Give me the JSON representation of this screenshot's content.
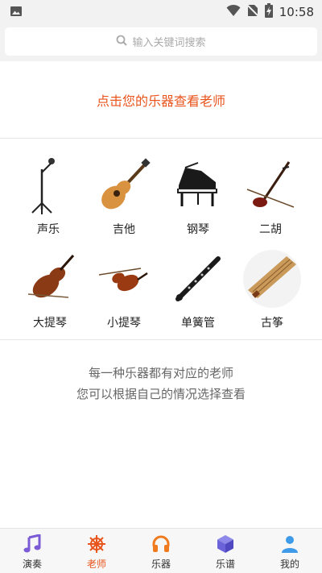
{
  "status_bar": {
    "time": "10:58"
  },
  "search": {
    "placeholder": "输入关键词搜索"
  },
  "prompt": {
    "text": "点击您的乐器查看老师"
  },
  "instruments": [
    {
      "label": "声乐",
      "icon": "microphone-stand-icon"
    },
    {
      "label": "吉他",
      "icon": "guitar-icon"
    },
    {
      "label": "钢琴",
      "icon": "grand-piano-icon"
    },
    {
      "label": "二胡",
      "icon": "erhu-icon"
    },
    {
      "label": "大提琴",
      "icon": "cello-icon"
    },
    {
      "label": "小提琴",
      "icon": "violin-icon"
    },
    {
      "label": "单簧管",
      "icon": "clarinet-icon"
    },
    {
      "label": "古筝",
      "icon": "guzheng-icon"
    }
  ],
  "info": {
    "line1": "每一种乐器都有对应的老师",
    "line2": "您可以根据自己的情况选择查看"
  },
  "tabs": [
    {
      "label": "演奏",
      "icon": "music-note-icon"
    },
    {
      "label": "老师",
      "icon": "ship-wheel-icon",
      "active": true
    },
    {
      "label": "乐器",
      "icon": "headphones-icon"
    },
    {
      "label": "乐谱",
      "icon": "cube-icon"
    },
    {
      "label": "我的",
      "icon": "user-icon"
    }
  ],
  "colors": {
    "accent": "#e8541c",
    "tab_music": "#7b5cd6",
    "tab_headphones": "#f07a1e",
    "tab_cube": "#6b63d9",
    "tab_user": "#3d9be9"
  }
}
